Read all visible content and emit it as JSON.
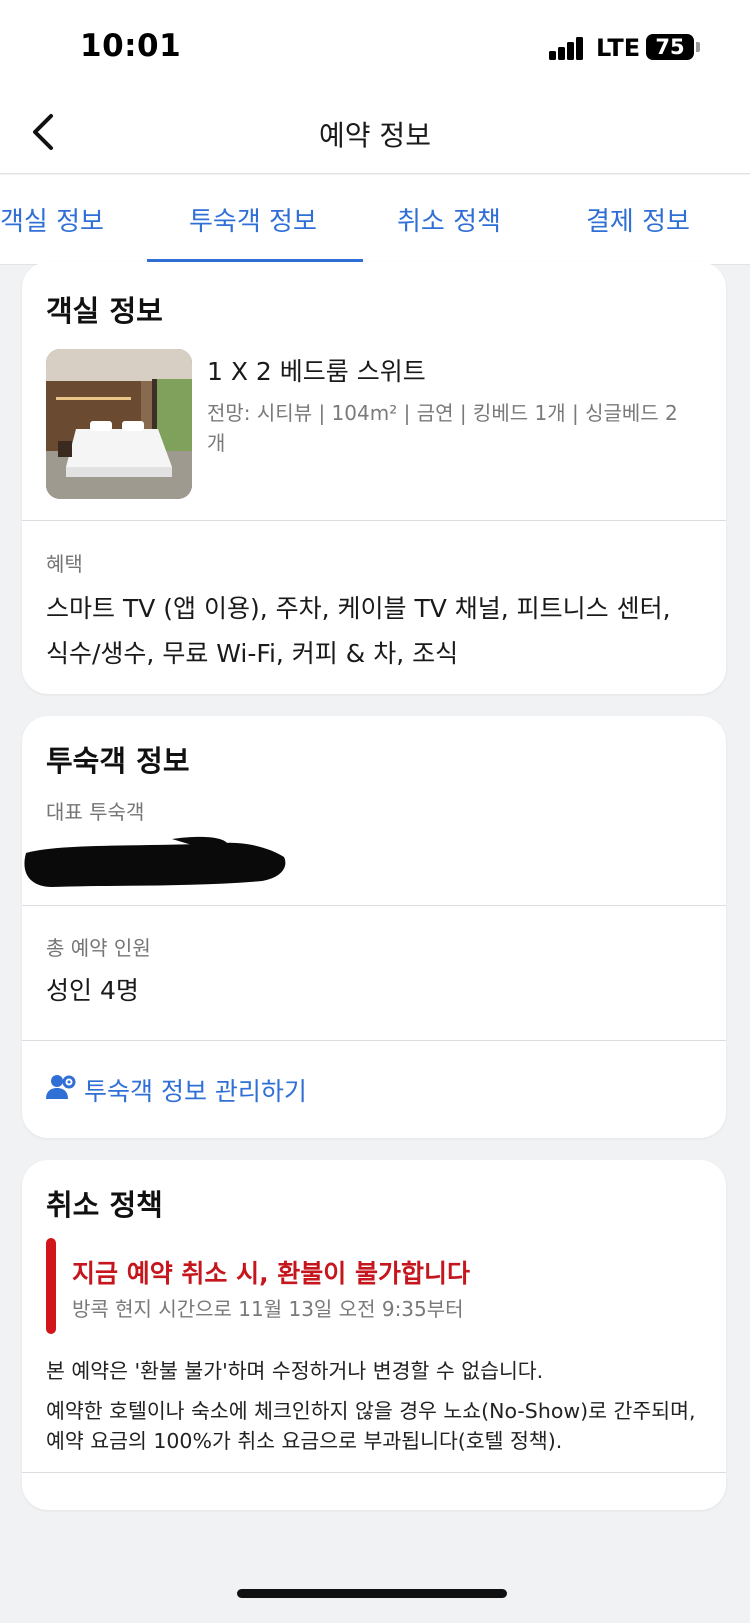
{
  "status_bar": {
    "time": "10:01",
    "network": "LTE",
    "battery": "75"
  },
  "header": {
    "title": "예약 정보",
    "back_icon": "chevron-left-icon"
  },
  "tabs": [
    {
      "label": "객실 정보",
      "active": false
    },
    {
      "label": "투숙객 정보",
      "active": true
    },
    {
      "label": "취소 정책",
      "active": false
    },
    {
      "label": "결제 정보",
      "active": false
    }
  ],
  "colors": {
    "accent": "#2f6fd6",
    "alert": "#c4161c",
    "background": "#f1f2f4"
  },
  "room_card": {
    "title": "객실 정보",
    "room_name": "1 X 2 베드룸 스위트",
    "room_desc": "전망: 시티뷰 | 104m² | 금연 | 킹베드 1개 | 싱글베드 2개",
    "benefits_label": "혜택",
    "benefits": "스마트 TV (앱 이용), 주차, 케이블 TV 채널, 피트니스 센터, 식수/생수, 무료 Wi-Fi, 커피 & 차, 조식"
  },
  "guest_card": {
    "title": "투숙객 정보",
    "main_guest_label": "대표 투숙객",
    "total_label": "총 예약 인원",
    "total_value": "성인 4명",
    "manage_link": "투숙객 정보 관리하기",
    "manage_icon": "user-gear-icon"
  },
  "cancel_card": {
    "title": "취소 정책",
    "alert_title": "지금 예약 취소 시, 환불이 불가합니다",
    "alert_sub": "방콕 현지 시간으로 11월 13일 오전 9:35부터",
    "policy_1": "본 예약은 '환불 불가'하며 수정하거나 변경할 수 없습니다.",
    "policy_2": "예약한 호텔이나 숙소에 체크인하지 않을 경우 노쇼(No-Show)로 간주되며, 예약 요금의 100%가 취소 요금으로 부과됩니다(호텔 정책)."
  }
}
